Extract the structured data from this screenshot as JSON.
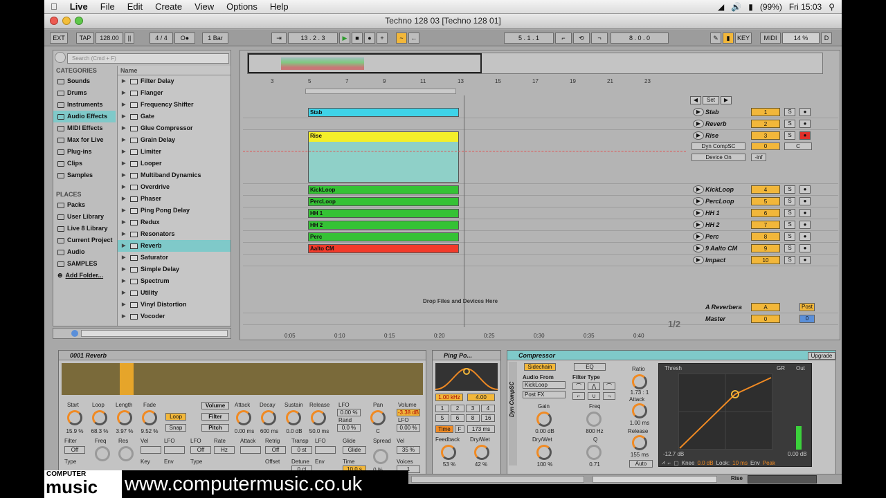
{
  "menubar": {
    "app": "Live",
    "items": [
      "File",
      "Edit",
      "Create",
      "View",
      "Options",
      "Help"
    ],
    "battery": "(99%)",
    "clock": "Fri 15:03"
  },
  "window": {
    "title": "Techno 128 03  [Techno 128 01]"
  },
  "control": {
    "ext": "EXT",
    "tap": "TAP",
    "tempo": "128.00",
    "signature": "4 / 4",
    "quantize": "1 Bar",
    "position": "13 .  2 .  3",
    "loop_start": "5 .  1 .  1",
    "loop_len": "8 .  0 .  0",
    "key": "KEY",
    "midi": "MIDI",
    "cpu": "14 %",
    "d": "D"
  },
  "browser": {
    "search_placeholder": "Search (Cmd + F)",
    "categories_header": "CATEGORIES",
    "categories": [
      "Sounds",
      "Drums",
      "Instruments",
      "Audio Effects",
      "MIDI Effects",
      "Max for Live",
      "Plug-ins",
      "Clips",
      "Samples"
    ],
    "selected_category": "Audio Effects",
    "places_header": "PLACES",
    "places": [
      "Packs",
      "User Library",
      "Live 8 Library",
      "Current Project",
      "Audio",
      "SAMPLES",
      "Add Folder..."
    ],
    "name_header": "Name",
    "items": [
      "Filter Delay",
      "Flanger",
      "Frequency Shifter",
      "Gate",
      "Glue Compressor",
      "Grain Delay",
      "Limiter",
      "Looper",
      "Multiband Dynamics",
      "Overdrive",
      "Phaser",
      "Ping Pong Delay",
      "Redux",
      "Resonators",
      "Reverb",
      "Saturator",
      "Simple Delay",
      "Spectrum",
      "Utility",
      "Vinyl Distortion",
      "Vocoder"
    ],
    "selected_item": "Reverb"
  },
  "arrangement": {
    "beat_ticks": [
      "3",
      "5",
      "7",
      "9",
      "11",
      "13",
      "15",
      "17",
      "19",
      "21",
      "23"
    ],
    "time_ticks": [
      "0:05",
      "0:10",
      "0:15",
      "0:20",
      "0:25",
      "0:30",
      "0:35",
      "0:40"
    ],
    "set_label": "Set",
    "drop_text": "Drop Files and Devices Here",
    "page_indicator": "1/2",
    "rise_device": "Dyn CompSC",
    "rise_param": "Device On",
    "rise_value": "-inf",
    "rise_pan": "C",
    "rise_num_value": "0",
    "tracks": [
      {
        "name": "Stab",
        "num": "1",
        "clip": "Stab",
        "color": "#3fd3e8"
      },
      {
        "name": "Reverb",
        "num": "2",
        "clip": "",
        "color": ""
      },
      {
        "name": "Rise",
        "num": "3",
        "clip": "Rise",
        "color": "#f4ef2a"
      },
      {
        "name": "KickLoop",
        "num": "4",
        "clip": "KickLoop",
        "color": "#35c235"
      },
      {
        "name": "PercLoop",
        "num": "5",
        "clip": "PercLoop",
        "color": "#35c235"
      },
      {
        "name": "HH 1",
        "num": "6",
        "clip": "HH 1",
        "color": "#35c235"
      },
      {
        "name": "HH 2",
        "num": "7",
        "clip": "HH 2",
        "color": "#35c235"
      },
      {
        "name": "Perc",
        "num": "8",
        "clip": "Perc",
        "color": "#35c235"
      },
      {
        "name": "9 Aalto CM",
        "num": "9",
        "clip": "Aalto CM",
        "color": "#f23a2a"
      },
      {
        "name": "Impact",
        "num": "10",
        "clip": "",
        "color": ""
      }
    ],
    "returns": [
      {
        "name": "A Reverbera",
        "num": "A",
        "extra": "Post"
      },
      {
        "name": "Master",
        "num": "0",
        "extra": "0"
      }
    ],
    "solo": "S"
  },
  "reverb_device": {
    "title": "0001 Reverb",
    "labels": [
      "Start",
      "Loop",
      "Length",
      "Fade"
    ],
    "values": [
      "15.9 %",
      "68.3 %",
      "3.97 %",
      "9.52 %"
    ],
    "loop_btn": "Loop",
    "snap_btn": "Snap",
    "volume_tab": "Volume",
    "filter_btn": "Filter",
    "pitch_btn": "Pitch",
    "env_labels": [
      "Attack",
      "Decay",
      "Sustain",
      "Release"
    ],
    "env_values": [
      "0.00 ms",
      "600 ms",
      "0.0 dB",
      "50.0 ms"
    ],
    "lfo": "LFO",
    "lfo_val": "0.00 %",
    "rand": "Rand",
    "rand_val": "0.0 %",
    "pan": "Pan",
    "pan_val": "C",
    "volume": "Volume",
    "volume_val": "-3.38 dB",
    "lfo2": "LFO",
    "lfo2_val": "0.00 %",
    "bottom_labels": [
      "Filter",
      "Freq",
      "Res",
      "Vel",
      "LFO",
      "LFO",
      "Rate",
      "Attack",
      "Retrig",
      "Transp",
      "LFO",
      "Glide",
      "Spread",
      "Vel"
    ],
    "type_label": "Type",
    "key_label": "Key",
    "env_label": "Env",
    "offset_label": "Offset",
    "detune_label": "Detune",
    "time_label": "Time",
    "voices_label": "Voices",
    "off": "Off",
    "hz": "Hz",
    "st": "0 st",
    "ct": "0 ct",
    "glide_val": "Glide",
    "time_val": "10.0 s",
    "spread_val": "0 %",
    "vel_val": "35 %",
    "voices_val": "1"
  },
  "pingpong_device": {
    "title": "Ping Po...",
    "freq": "1.00 kHz",
    "width": "4.00",
    "steps": [
      "1",
      "2",
      "3",
      "4",
      "5",
      "6",
      "8",
      "16"
    ],
    "time_btn": "Time",
    "f_btn": "F",
    "time_val": "173 ms",
    "feedback": "Feedback",
    "feedback_val": "53 %",
    "drywet": "Dry/Wet",
    "drywet_val": "42 %"
  },
  "compressor": {
    "title": "Compressor",
    "upgrade": "Upgrade",
    "sidechain_btn": "Sidechain",
    "eq_btn": "EQ",
    "audio_from": "Audio From",
    "source": "KickLoop",
    "tap": "Post FX",
    "gain": "Gain",
    "gain_val": "0.00 dB",
    "drywet": "Dry/Wet",
    "drywet_val": "100 %",
    "filter_type": "Filter Type",
    "freq": "Freq",
    "freq_val": "800 Hz",
    "q": "Q",
    "q_val": "0.71",
    "ratio": "Ratio",
    "ratio_val": "1.73 : 1",
    "attack": "Attack",
    "attack_val": "1.00 ms",
    "release": "Release",
    "release_val": "155 ms",
    "auto": "Auto",
    "thresh": "Thresh",
    "gr": "GR",
    "out": "Out",
    "thresh_val": "-12.7 dB",
    "out_val": "0.00 dB",
    "knee": "Knee",
    "knee_val": "0.0 dB",
    "look": "Look:",
    "look_val": "10 ms",
    "env": "Env",
    "env_val": "Peak",
    "side_label": "Dyn CompSC"
  },
  "statusbar": {
    "track": "Rise"
  },
  "watermark": {
    "brand_top": "COMPUTER",
    "brand": "music",
    "url": "www.computermusic.co.uk"
  }
}
